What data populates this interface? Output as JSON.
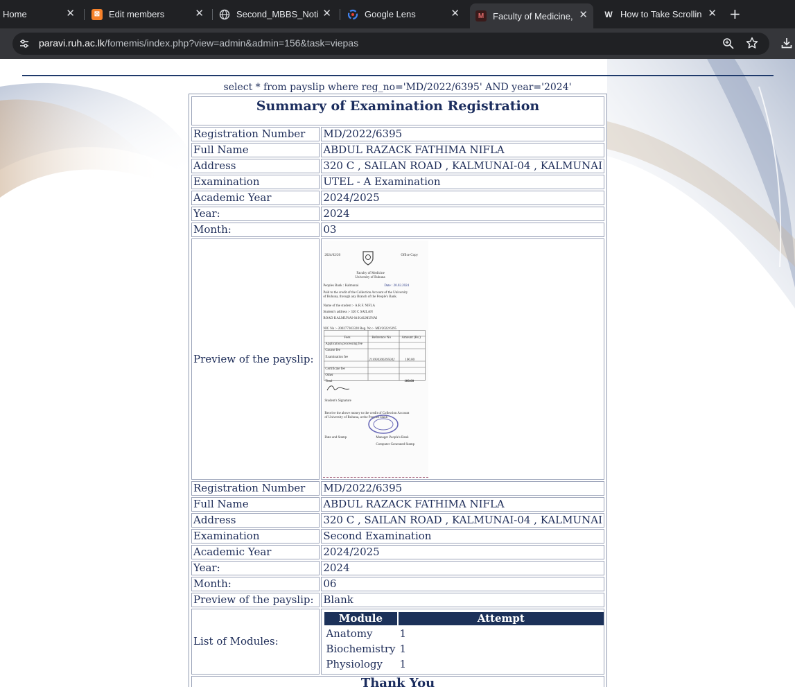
{
  "browser": {
    "tabs": [
      {
        "title": "Home",
        "favicon": "home-page-icon"
      },
      {
        "title": "Edit members",
        "favicon": "xampp-icon"
      },
      {
        "title": "Second_MBBS_Notice",
        "favicon": "globe-icon"
      },
      {
        "title": "Google Lens",
        "favicon": "google-icon"
      },
      {
        "title": "Faculty of Medicine, U",
        "favicon": "faculty-icon",
        "active": true
      },
      {
        "title": "How to Take Scrolling",
        "favicon": "wikihow-icon"
      }
    ],
    "url_host": "paravi.ruh.ac.lk",
    "url_path": "/fomemis/index.php?view=admin&admin=156&task=viepas"
  },
  "page": {
    "query": "select * from payslip where reg_no='MD/2022/6395' AND year='2024'",
    "title": "Summary of Examination Registration",
    "labels": {
      "reg_no": "Registration Number",
      "full_name": "Full Name",
      "address": "Address",
      "examination": "Examination",
      "academic_year": "Academic Year",
      "year": "Year:",
      "month": "Month:",
      "preview": "Preview of the payslip:",
      "modules": "List of Modules:"
    },
    "record1": {
      "reg_no": "MD/2022/6395",
      "full_name": "ABDUL RAZACK FATHIMA NIFLA",
      "address": "320 C , SAILAN ROAD , KALMUNAI-04 , KALMUNAI",
      "examination": "UTEL - A Examination",
      "academic_year": "2024/2025",
      "year": "2024",
      "month": "03"
    },
    "record2": {
      "reg_no": "MD/2022/6395",
      "full_name": "ABDUL RAZACK FATHIMA NIFLA",
      "address": "320 C , SAILAN ROAD , KALMUNAI-04 , KALMUNAI",
      "examination": "Second Examination",
      "academic_year": "2024/2025",
      "year": "2024",
      "month": "06",
      "preview": "Blank"
    },
    "modules_table": {
      "headers": [
        "Module",
        "Attempt"
      ],
      "rows": [
        {
          "module": "Anatomy",
          "attempt": "1"
        },
        {
          "module": "Biochemistry",
          "attempt": "1"
        },
        {
          "module": "Physiology",
          "attempt": "1"
        }
      ]
    },
    "thank_you": "Thank You"
  },
  "payslip": {
    "date": "2024/02/20",
    "copy": "Office Copy",
    "faculty": "Faculty of Medicine",
    "university": "University of Ruhuna",
    "bank_line": "Peoples Bank : Kalmunai",
    "date_stamp": "Date : 20.02.2024",
    "paid_line_1": "Paid to the credit of the Collection Account of the University",
    "paid_line_2": "of Ruhuna, through any Branch of the People's Bank.",
    "student_name": "Name of the student :- A.R.F. NIFLA",
    "student_address_1": "Student's address :- 320 C SAILAN",
    "student_address_2": "ROAD KALMUNAI-04 KALMUNAI",
    "nic_reg": "NIC No :- 200277303320      Reg. No :- MD/2022/6395",
    "col_fees": "Fees",
    "col_ref": "Reference No",
    "col_amount": "Amount (Rs.)",
    "row_app": "Application processing fee",
    "row_course": "Course fee",
    "row_exam": "Examination fee",
    "exam_ref": "211004306395042",
    "exam_amount": "100.00",
    "row_cert": "Certificate fee",
    "row_other": "Other",
    "row_total": "Total",
    "total_amount": "100.00",
    "student_sig": "Student's Signature",
    "receive_1": "Receive the above money to the credit of Collection Account",
    "receive_2": "of University of Ruhuna, at the Peoples Bank",
    "date_and_stamp": "Date and Stamp",
    "manager": "Manager People's Bank",
    "computer_stamp": "Computer Generated Stamp"
  }
}
